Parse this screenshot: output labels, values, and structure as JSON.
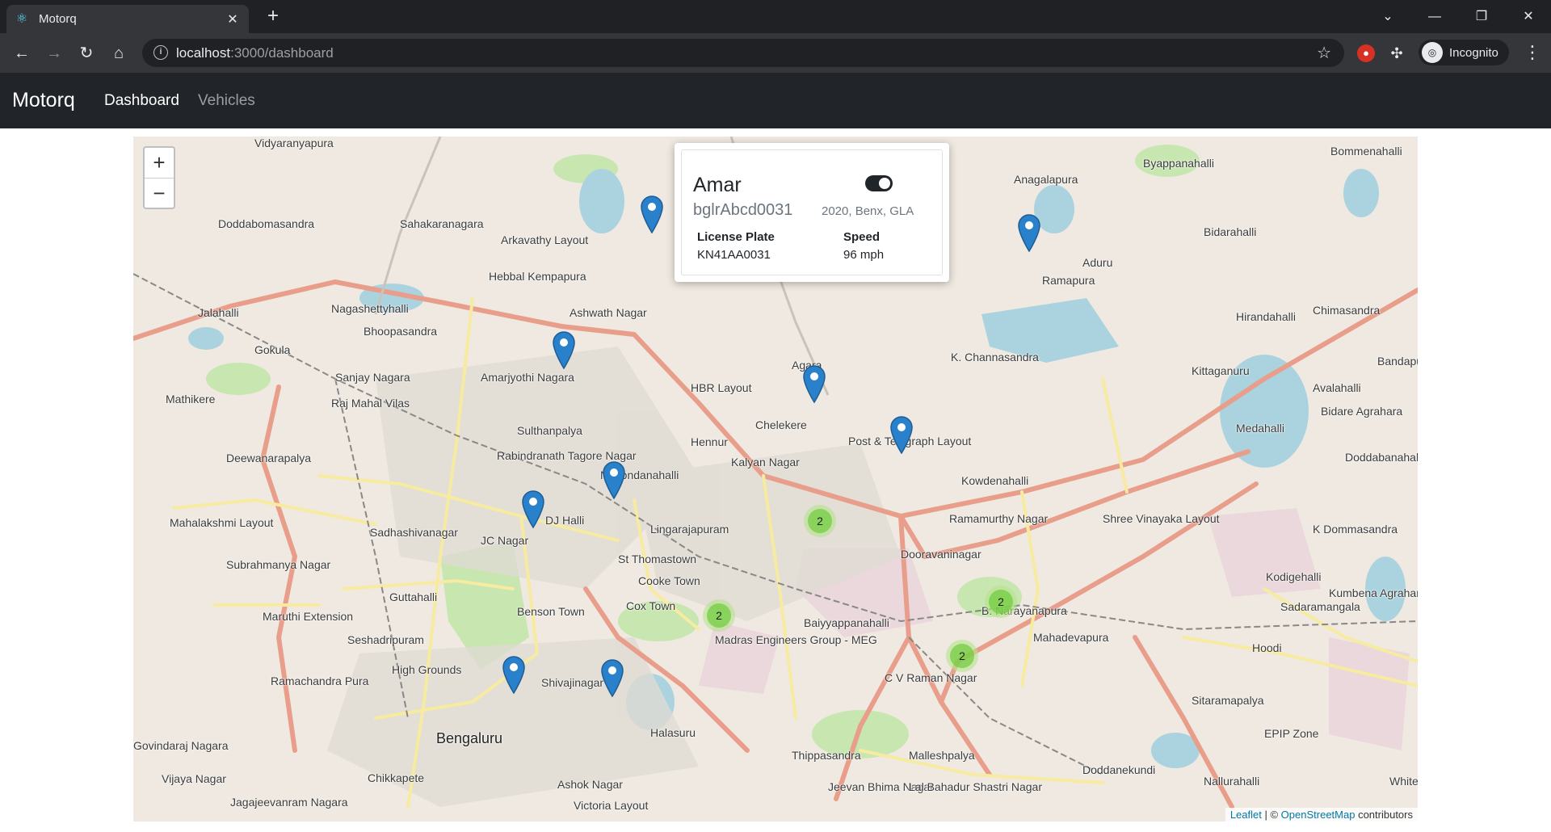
{
  "browser": {
    "tab_title": "Motorq",
    "url_host": "localhost",
    "url_path": ":3000/dashboard",
    "profile_label": "Incognito"
  },
  "app": {
    "brand": "Motorq",
    "nav": [
      {
        "label": "Dashboard",
        "active": true
      },
      {
        "label": "Vehicles",
        "active": false
      }
    ]
  },
  "map": {
    "zoom_in": "+",
    "zoom_out": "−",
    "places": [
      "Vidyaranyapura",
      "Doddabomasandra",
      "Sahakaranagara",
      "Arkavathy Layout",
      "Hebbal Kempapura",
      "Jalahalli",
      "Nagashettyhalli",
      "Bhoopasandra",
      "Gokula",
      "Sanjay Nagara",
      "Mathikere",
      "Raj Mahal Vilas",
      "Amarjyothi Nagara",
      "Ashwath Nagar",
      "HBR Layout",
      "Agara",
      "Chelekere",
      "Hennur",
      "Kalyan Nagar",
      "Post & Telegraph Layout",
      "Sulthanpalya",
      "Rabindranath Tagore Nagar",
      "Nagondanahalli",
      "Deewanarapalya",
      "Mahalakshmi Layout",
      "Sadhashivanagar",
      "DJ Halli",
      "JC Nagar",
      "Lingarajapuram",
      "St Thomastown",
      "Cooke Town",
      "Cox Town",
      "Benson Town",
      "Subrahmanya Nagar",
      "Guttahalli",
      "Maruthi Extension",
      "Seshadripuram",
      "High Grounds",
      "Ramachandra Pura",
      "Shivajinagar",
      "Bengaluru",
      "Halasuru",
      "Baiyyappanahalli",
      "C V Raman Nagar",
      "Thippasandra",
      "Malleshpalya",
      "Jeevan Bhima Nagar",
      "Lal Bahadur Shastri Nagar",
      "Ashok Nagar",
      "Victoria Layout",
      "Chikkapete",
      "Jagajeevanram Nagara",
      "Vijaya Nagar",
      "Govindaraj Nagara",
      "K. Channasandra",
      "Kowdenahalli",
      "Ramamurthy Nagar",
      "Dooravaninagar",
      "B. Narayanapura",
      "Mahadevapura",
      "Shree Vinayaka Layout",
      "Anagalapura",
      "Ramapura",
      "Byappanahalli",
      "Bommenahalli",
      "Bidarahalli",
      "Aduru",
      "Hirandahalli",
      "Chimasandra",
      "Kittaganuru",
      "Medahalli",
      "Avalahalli",
      "Bidare Agrahara",
      "Doddabanahalli",
      "K Dommasandra",
      "Kodigehalli",
      "Kumbena Agrahara",
      "Sadaramangala",
      "Hoodi",
      "Sitaramapalya",
      "EPIP Zone",
      "Doddanekundi",
      "Nallurahalli",
      "White",
      "Bandapura",
      "Madras Engineers Group - MEG"
    ],
    "clusters": [
      "2",
      "2",
      "2",
      "2"
    ],
    "attribution": {
      "leaflet": "Leaflet",
      "sep": " | © ",
      "osm": "OpenStreetMap",
      "tail": " contributors"
    }
  },
  "popup": {
    "name": "Amar",
    "vehicle_id": "bglrAbcd0031",
    "meta": "2020, Benx, GLA",
    "license_label": "License Plate",
    "license_value": "KN41AA0031",
    "speed_label": "Speed",
    "speed_value": "96 mph",
    "toggle_on": true
  }
}
